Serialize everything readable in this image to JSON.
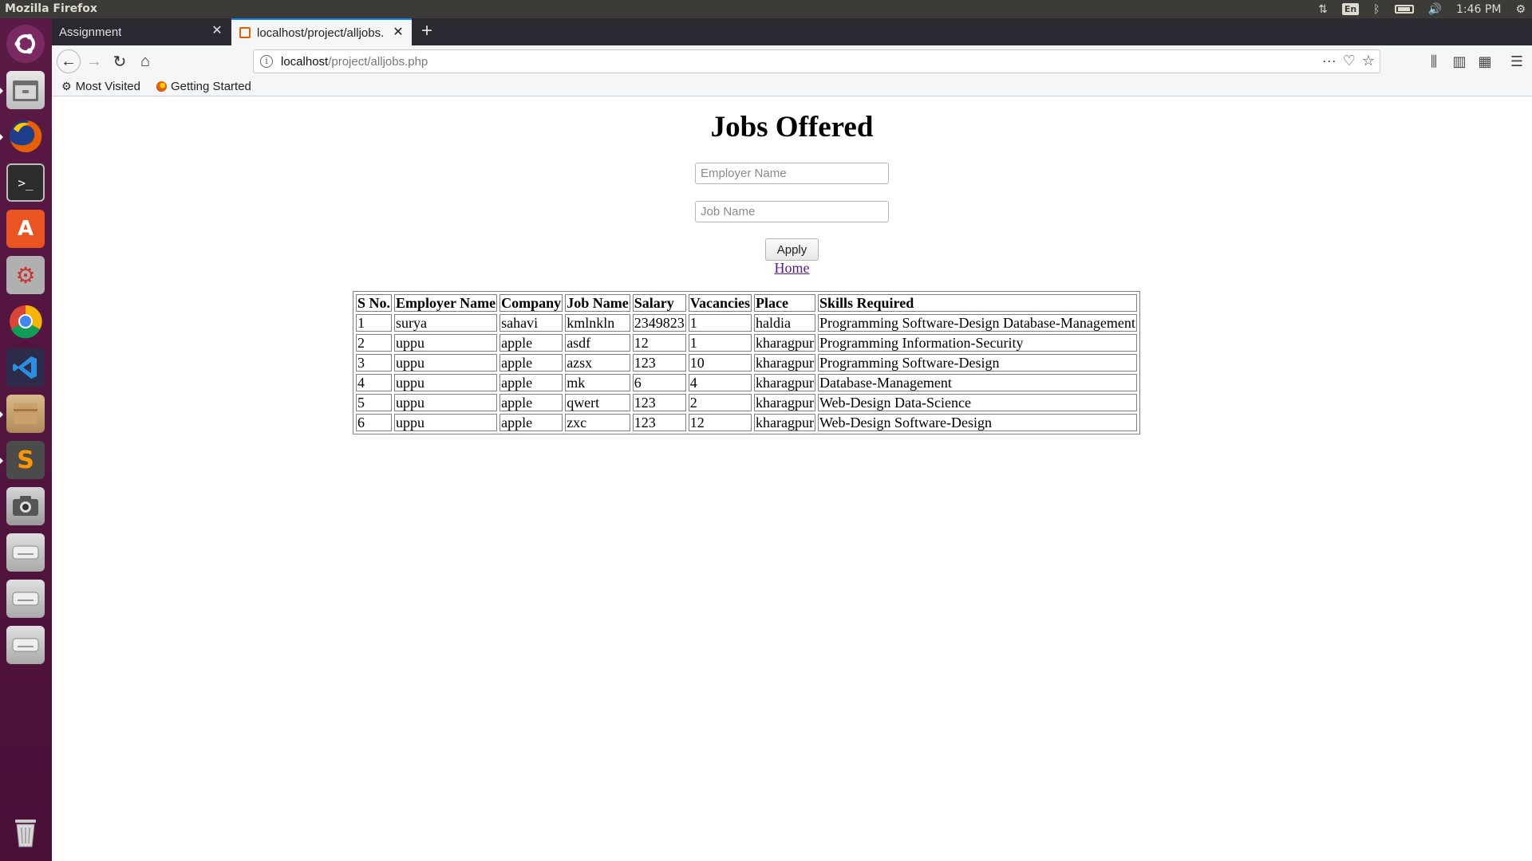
{
  "os": {
    "window_title": "Mozilla Firefox",
    "keyboard_layout": "En",
    "clock": "1:46 PM"
  },
  "browser": {
    "tabs": [
      {
        "label": "Assignment"
      },
      {
        "label": "localhost/project/alljobs.php"
      }
    ],
    "url_host": "localhost",
    "url_path": "/project/alljobs.php",
    "bookmarks": [
      {
        "label": "Most Visited"
      },
      {
        "label": "Getting Started"
      }
    ]
  },
  "page": {
    "title": "Jobs Offered",
    "employer_placeholder": "Employer Name",
    "job_placeholder": "Job Name",
    "apply_label": "Apply",
    "home_label": "Home",
    "table": {
      "headers": [
        "S No.",
        "Employer Name",
        "Company",
        "Job Name",
        "Salary",
        "Vacancies",
        "Place",
        "Skills Required"
      ],
      "rows": [
        [
          "1",
          "surya",
          "sahavi",
          "kmlnkln",
          "2349823",
          "1",
          "haldia",
          "Programming Software-Design Database-Management"
        ],
        [
          "2",
          "uppu",
          "apple",
          "asdf",
          "12",
          "1",
          "kharagpur",
          "Programming Information-Security"
        ],
        [
          "3",
          "uppu",
          "apple",
          "azsx",
          "123",
          "10",
          "kharagpur",
          "Programming Software-Design"
        ],
        [
          "4",
          "uppu",
          "apple",
          "mk",
          "6",
          "4",
          "kharagpur",
          "Database-Management"
        ],
        [
          "5",
          "uppu",
          "apple",
          "qwert",
          "123",
          "2",
          "kharagpur",
          "Web-Design Data-Science"
        ],
        [
          "6",
          "uppu",
          "apple",
          "zxc",
          "123",
          "12",
          "kharagpur",
          "Web-Design Software-Design"
        ]
      ]
    }
  },
  "colors": {
    "panel": "#3c3b37",
    "launcher": "#5a1a45",
    "tabstrip": "#2b2a33",
    "toolbar": "#f5f6f7",
    "active_tab_accent": "#0a84ff",
    "link_visited": "#551a8b"
  },
  "icons": {
    "launcher": [
      "ubuntu-dash-icon",
      "files-icon",
      "firefox-icon",
      "terminal-icon",
      "software-center-icon",
      "system-settings-icon",
      "chrome-icon",
      "vscode-icon",
      "archive-icon",
      "sublime-text-icon",
      "camera-icon",
      "drive-icon",
      "drive-icon",
      "drive-icon",
      "trash-icon"
    ]
  }
}
